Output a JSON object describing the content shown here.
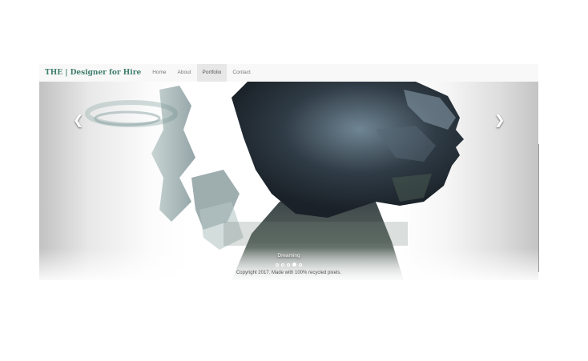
{
  "navbar": {
    "brand": "THE | Designer for Hire",
    "items": [
      {
        "label": "Home",
        "active": false
      },
      {
        "label": "About",
        "active": false
      },
      {
        "label": "Portfolio",
        "active": true
      },
      {
        "label": "Contact",
        "active": false
      }
    ]
  },
  "carousel": {
    "caption": "Dreaming",
    "prev_icon": "chevron-left-icon",
    "next_icon": "chevron-right-icon",
    "indicator_count": 5,
    "active_indicator": 4
  },
  "footer": {
    "text": "Copyright 2017. Made with 100% recycled pixels."
  },
  "colors": {
    "brand": "#3f7e6d",
    "navbar_bg": "#f8f8f8",
    "nav_active_bg": "#e7e7e7"
  }
}
